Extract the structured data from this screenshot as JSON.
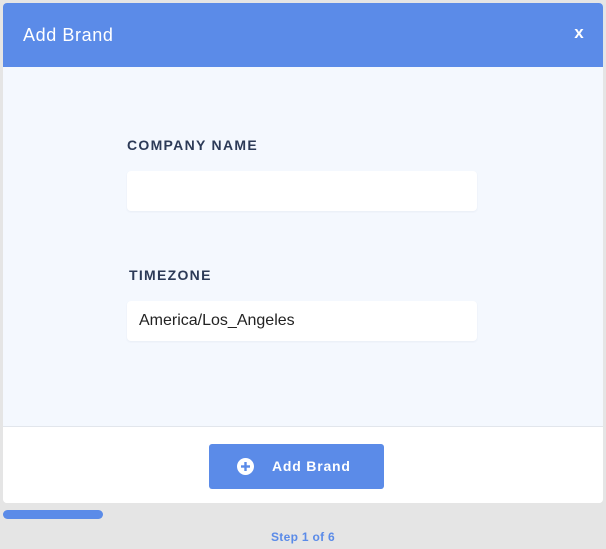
{
  "modal": {
    "title": "Add Brand",
    "close_label": "x"
  },
  "form": {
    "company_name": {
      "label": "COMPANY NAME",
      "value": ""
    },
    "timezone": {
      "label": "TIMEZONE",
      "value": "America/Los_Angeles"
    }
  },
  "footer": {
    "submit_label": "Add Brand",
    "submit_icon": "plus-circle-icon"
  },
  "progress": {
    "step_text": "Step 1 of 6",
    "current_step": 1,
    "total_steps": 6
  },
  "colors": {
    "accent": "#5b8be8",
    "body_bg": "#f4f8fe",
    "label": "#2c3a57"
  }
}
